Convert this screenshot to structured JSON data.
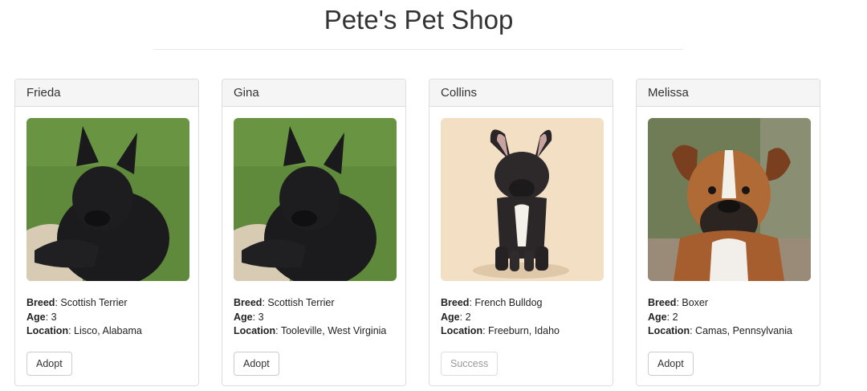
{
  "header": {
    "title": "Pete's Pet Shop"
  },
  "labels": {
    "breed": "Breed",
    "age": "Age",
    "location": "Location",
    "separator": ": "
  },
  "pets": [
    {
      "name": "Frieda",
      "breed": "Scottish Terrier",
      "age": "3",
      "location": "Lisco, Alabama",
      "button": "Adopt",
      "button_state": "enabled",
      "photo": "scottish-terrier-photo"
    },
    {
      "name": "Gina",
      "breed": "Scottish Terrier",
      "age": "3",
      "location": "Tooleville, West Virginia",
      "button": "Adopt",
      "button_state": "enabled",
      "photo": "scottish-terrier-photo"
    },
    {
      "name": "Collins",
      "breed": "French Bulldog",
      "age": "2",
      "location": "Freeburn, Idaho",
      "button": "Success",
      "button_state": "disabled",
      "photo": "french-bulldog-photo"
    },
    {
      "name": "Melissa",
      "breed": "Boxer",
      "age": "2",
      "location": "Camas, Pennsylvania",
      "button": "Adopt",
      "button_state": "enabled",
      "photo": "boxer-photo"
    }
  ]
}
